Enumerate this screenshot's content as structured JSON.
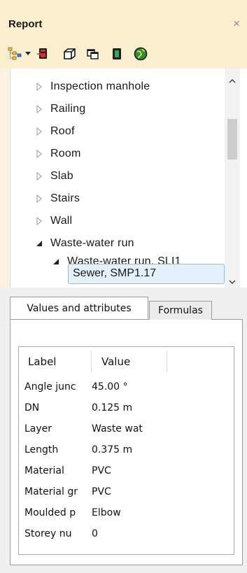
{
  "panel": {
    "title": "Report",
    "close_glyph": "×"
  },
  "toolbar": {
    "buttons": [
      {
        "icon": "hierarchy-icon"
      },
      {
        "icon": "export-red-icon"
      },
      {
        "icon": "3d-box-icon"
      },
      {
        "icon": "copy-windows-icon"
      },
      {
        "icon": "report-book-icon"
      },
      {
        "icon": "globe-icon"
      }
    ]
  },
  "tree": {
    "items": [
      {
        "label": "Inspection manhole",
        "expanded": false
      },
      {
        "label": "Railing",
        "expanded": false
      },
      {
        "label": "Roof",
        "expanded": false
      },
      {
        "label": "Room",
        "expanded": false
      },
      {
        "label": "Slab",
        "expanded": false
      },
      {
        "label": "Stairs",
        "expanded": false
      },
      {
        "label": "Wall",
        "expanded": false
      },
      {
        "label": "Waste-water run",
        "expanded": true
      },
      {
        "label": "Waste-water run, SLI1",
        "expanded": true
      },
      {
        "label": "Sewer, SMP1.17",
        "selected": true
      }
    ]
  },
  "tabs": {
    "active": "Values and attributes",
    "inactive": "Formulas"
  },
  "grid": {
    "columns": [
      "Label",
      "Value"
    ],
    "rows": [
      {
        "label": "Angle junc",
        "value": "45.00 °"
      },
      {
        "label": "DN",
        "value": "0.125 m"
      },
      {
        "label": "Layer",
        "value": "Waste wat"
      },
      {
        "label": "Length",
        "value": "0.375 m"
      },
      {
        "label": "Material",
        "value": "PVC"
      },
      {
        "label": "Material gr",
        "value": "PVC"
      },
      {
        "label": "Moulded p",
        "value": "Elbow"
      },
      {
        "label": "Storey nu",
        "value": "0"
      }
    ]
  }
}
